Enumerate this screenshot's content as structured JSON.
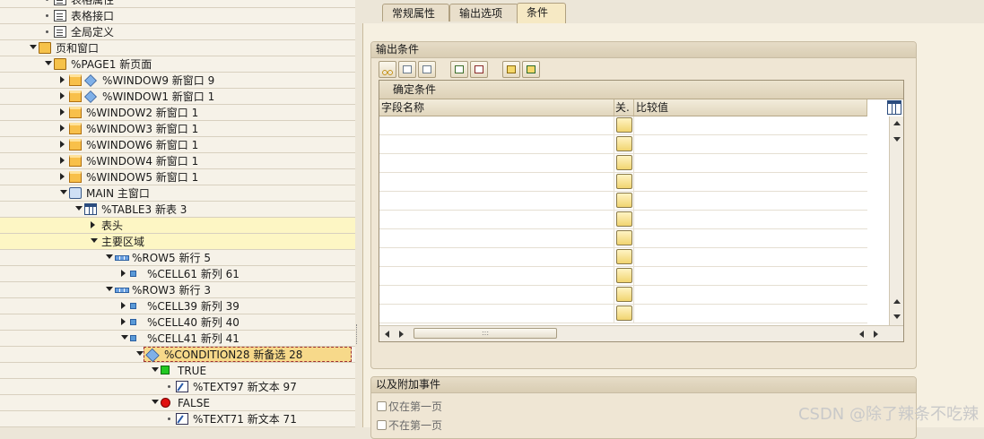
{
  "tree": [
    {
      "label": "表格属性",
      "icon": "document-icon",
      "type": "doc",
      "depth": 1,
      "dot": true
    },
    {
      "label": "表格接口",
      "icon": "document-icon",
      "type": "doc",
      "depth": 1,
      "dot": true
    },
    {
      "label": "全局定义",
      "icon": "document-icon",
      "type": "doc",
      "depth": 1,
      "dot": true
    },
    {
      "label": "页和窗口",
      "icon": "folder-open-icon",
      "type": "folder",
      "depth": 0,
      "chev": "open"
    },
    {
      "label": "%PAGE1 新页面",
      "icon": "folder-open-icon",
      "type": "folder",
      "depth": 1,
      "chev": "open"
    },
    {
      "label": "%WINDOW9 新窗口 9",
      "icon": "window-icon",
      "type": "win2",
      "depth": 2,
      "chev": "closed"
    },
    {
      "label": "%WINDOW1 新窗口 1",
      "icon": "window-icon",
      "type": "win2",
      "depth": 2,
      "chev": "closed"
    },
    {
      "label": "%WINDOW2 新窗口 1",
      "icon": "window-icon",
      "type": "win",
      "depth": 2,
      "chev": "closed"
    },
    {
      "label": "%WINDOW3 新窗口 1",
      "icon": "window-icon",
      "type": "win",
      "depth": 2,
      "chev": "closed"
    },
    {
      "label": "%WINDOW6 新窗口 1",
      "icon": "window-icon",
      "type": "win",
      "depth": 2,
      "chev": "closed"
    },
    {
      "label": "%WINDOW4 新窗口 1",
      "icon": "window-icon",
      "type": "win",
      "depth": 2,
      "chev": "closed"
    },
    {
      "label": "%WINDOW5 新窗口 1",
      "icon": "window-icon",
      "type": "win",
      "depth": 2,
      "chev": "closed"
    },
    {
      "label": "MAIN 主窗口",
      "icon": "main-window-icon",
      "type": "main",
      "depth": 2,
      "chev": "open"
    },
    {
      "label": "%TABLE3 新表 3",
      "icon": "table-icon",
      "type": "table",
      "depth": 3,
      "chev": "open"
    },
    {
      "label": "表头",
      "type": "none",
      "depth": 4,
      "chev": "closed",
      "hl": true
    },
    {
      "label": "主要区域",
      "type": "none",
      "depth": 4,
      "chev": "open",
      "hl": true
    },
    {
      "label": "%ROW5 新行 5",
      "icon": "row-icon",
      "type": "rowbar",
      "depth": 5,
      "chev": "open"
    },
    {
      "label": "%CELL61 新列 61",
      "icon": "cell-icon",
      "type": "cell",
      "depth": 6,
      "chev": "closed"
    },
    {
      "label": "%ROW3 新行 3",
      "icon": "row-icon",
      "type": "rowbar",
      "depth": 5,
      "chev": "open"
    },
    {
      "label": "%CELL39 新列 39",
      "icon": "cell-icon",
      "type": "cell",
      "depth": 6,
      "chev": "closed"
    },
    {
      "label": "%CELL40 新列 40",
      "icon": "cell-icon",
      "type": "cell",
      "depth": 6,
      "chev": "closed"
    },
    {
      "label": "%CELL41 新列 41",
      "icon": "cell-icon",
      "type": "cell",
      "depth": 6,
      "chev": "open"
    },
    {
      "label": "%CONDITION28 新备选 28",
      "icon": "condition-icon",
      "type": "cond",
      "depth": 7,
      "chev": "open",
      "selected": true
    },
    {
      "label": "TRUE",
      "icon": "true-branch-icon",
      "type": "green",
      "depth": 8,
      "chev": "open"
    },
    {
      "label": "%TEXT97 新文本 97",
      "icon": "text-node-icon",
      "type": "text",
      "depth": 9,
      "dot": true
    },
    {
      "label": "FALSE",
      "icon": "false-branch-icon",
      "type": "red",
      "depth": 8,
      "chev": "open"
    },
    {
      "label": "%TEXT71 新文本 71",
      "icon": "text-node-icon",
      "type": "text",
      "depth": 9,
      "dot": true
    }
  ],
  "tabs": [
    {
      "label": "常规属性",
      "active": false
    },
    {
      "label": "输出选项",
      "active": false
    },
    {
      "label": "条件",
      "active": true
    }
  ],
  "output_conditions": {
    "title": "输出条件",
    "toolbar": [
      {
        "name": "cut-button",
        "kind": "scissors"
      },
      {
        "name": "copy-button",
        "kind": "copy"
      },
      {
        "name": "paste-button",
        "kind": "paste"
      },
      {
        "name": "insert-row-button",
        "kind": "addr"
      },
      {
        "name": "delete-row-button",
        "kind": "delr"
      },
      {
        "name": "check-button",
        "kind": "ygl"
      },
      {
        "name": "condition-editor-button",
        "kind": "yglx"
      }
    ],
    "grid_title": "确定条件",
    "columns": [
      "字段名称",
      "关.",
      "比较值"
    ],
    "row_count": 11,
    "hscroll_thumb": ":::"
  },
  "events": {
    "title": "以及附加事件",
    "options": [
      {
        "label": "仅在第一页",
        "checked": false
      },
      {
        "label": "不在第一页",
        "checked": false
      }
    ]
  },
  "watermark": "CSDN @除了辣条不吃辣"
}
